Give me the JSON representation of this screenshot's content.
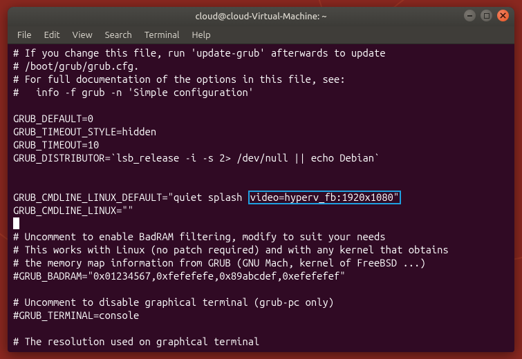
{
  "titlebar": {
    "title": "cloud@cloud-Virtual-Machine: ~"
  },
  "menu": {
    "file": "File",
    "edit": "Edit",
    "view": "View",
    "search": "Search",
    "terminal": "Terminal",
    "help": "Help"
  },
  "term": {
    "l01": "# If you change this file, run 'update-grub' afterwards to update",
    "l02": "# /boot/grub/grub.cfg.",
    "l03": "# For full documentation of the options in this file, see:",
    "l04": "#   info -f grub -n 'Simple configuration'",
    "l05": "",
    "l06": "GRUB_DEFAULT=0",
    "l07": "GRUB_TIMEOUT_STYLE=hidden",
    "l08": "GRUB_TIMEOUT=10",
    "l09": "GRUB_DISTRIBUTOR=`lsb_release -i -s 2> /dev/null || echo Debian`",
    "l10": "",
    "l11": "",
    "l12a": "GRUB_CMDLINE_LINUX_DEFAULT=\"quiet splash ",
    "l12b": "video=hyperv_fb:1920x1080\"",
    "l13": "GRUB_CMDLINE_LINUX=\"\"",
    "l14": "",
    "l15": "# Uncomment to enable BadRAM filtering, modify to suit your needs",
    "l16": "# This works with Linux (no patch required) and with any kernel that obtains",
    "l17": "# the memory map information from GRUB (GNU Mach, kernel of FreeBSD ...)",
    "l18": "#GRUB_BADRAM=\"0x01234567,0xfefefefe,0x89abcdef,0xefefefef\"",
    "l19": "",
    "l20": "# Uncomment to disable graphical terminal (grub-pc only)",
    "l21": "#GRUB_TERMINAL=console",
    "l22": "",
    "l23": "# The resolution used on graphical terminal"
  }
}
